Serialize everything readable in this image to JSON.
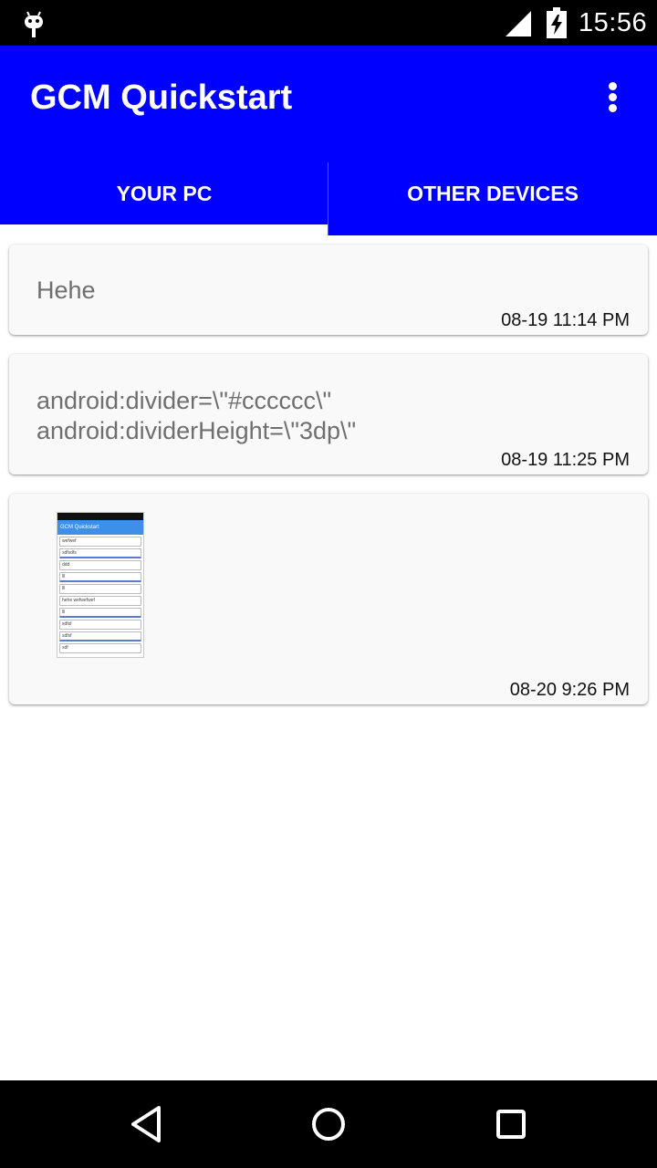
{
  "status_bar": {
    "time": "15:56",
    "icons": [
      "android-debug-icon",
      "signal-icon",
      "battery-charging-icon"
    ]
  },
  "app_bar": {
    "title": "GCM Quickstart",
    "menu_icon": "overflow-menu-icon",
    "color": "#0000ff"
  },
  "tabs": [
    {
      "label": "YOUR PC",
      "selected": true
    },
    {
      "label": "OTHER DEVICES",
      "selected": false
    }
  ],
  "messages": [
    {
      "text": "Hehe",
      "time": "08-19 11:14 PM"
    },
    {
      "text": "android:divider=\\\"#cccccc\\\"\nandroid:dividerHeight=\\\"3dp\\\"",
      "time": "08-19 11:25 PM"
    },
    {
      "type": "image",
      "time": "08-20 9:26 PM",
      "thumbnail": {
        "title": "GCM Quickstart",
        "rows": [
          "wefwef",
          "sdfsdfs",
          "ddd",
          "lll",
          "lll",
          "hehe wefwefwef",
          "lll",
          "sdfsf",
          "sdfsf",
          "sdf"
        ]
      }
    }
  ],
  "nav_bar": {
    "buttons": [
      "back-icon",
      "home-icon",
      "recents-icon"
    ]
  }
}
